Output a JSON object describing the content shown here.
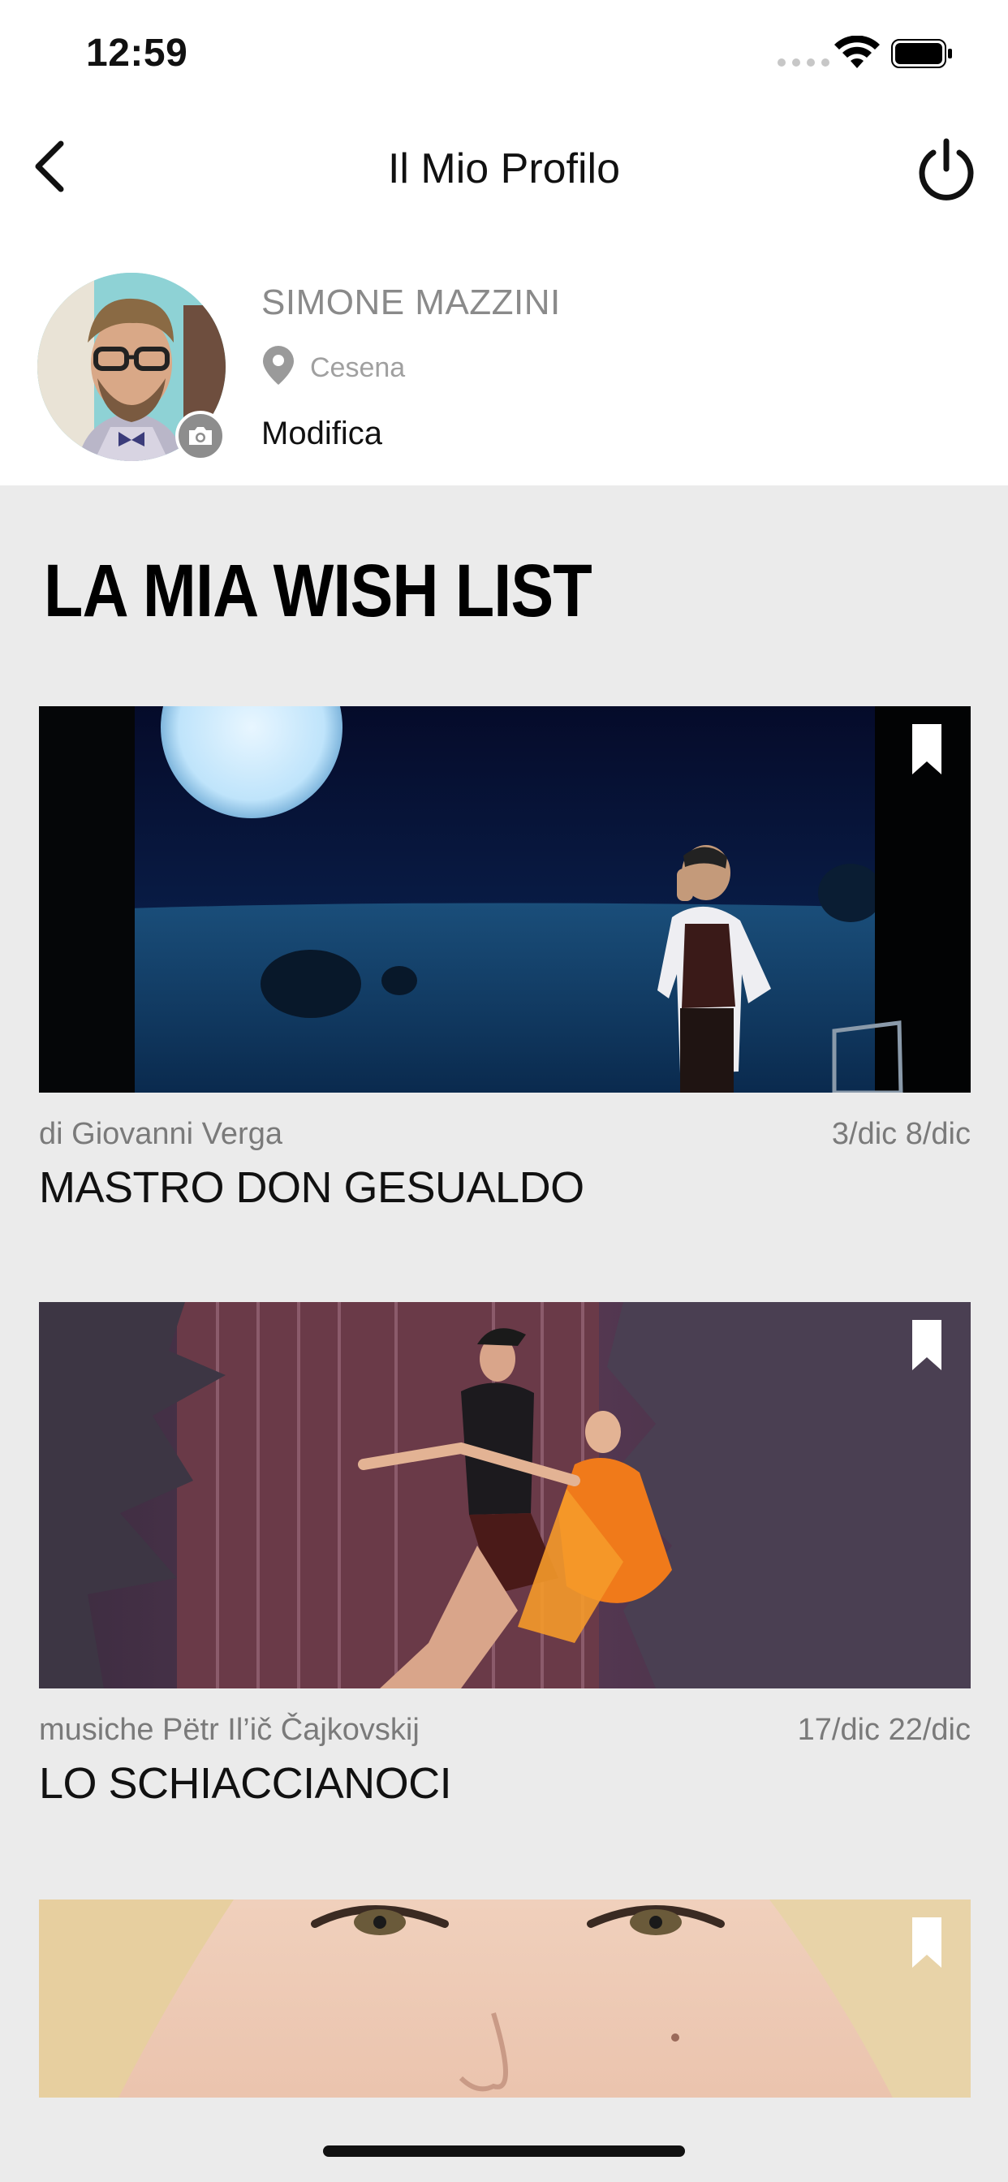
{
  "status_bar": {
    "time": "12:59"
  },
  "header": {
    "title": "Il Mio Profilo"
  },
  "profile": {
    "name": "SIMONE MAZZINI",
    "location": "Cesena",
    "edit_label": "Modifica"
  },
  "wishlist": {
    "title": "LA MIA WISH LIST",
    "items": [
      {
        "author": "di Giovanni Verga",
        "dates": "3/dic 8/dic",
        "title": "MASTRO DON GESUALDO"
      },
      {
        "author": "musiche Pëtr Il’ič Čajkovskij",
        "dates": "17/dic 22/dic",
        "title": "LO SCHIACCIANOCI"
      }
    ]
  },
  "colors": {
    "background": "#ebebeb",
    "surface": "#ffffff",
    "text_primary": "#111111",
    "text_secondary": "#8a8a8a"
  },
  "icons": [
    "back-chevron-icon",
    "power-icon",
    "camera-icon",
    "location-pin-icon",
    "bookmark-icon",
    "wifi-icon",
    "battery-icon",
    "signal-icon"
  ]
}
